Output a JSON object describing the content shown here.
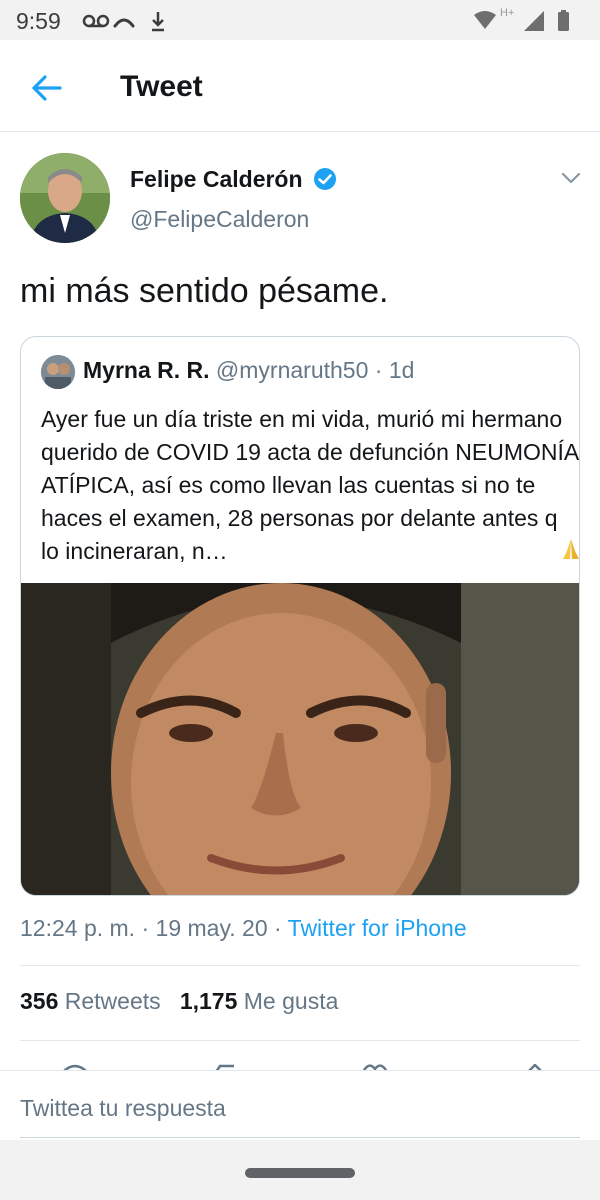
{
  "status_bar": {
    "time": "9:59",
    "network_label": "H+",
    "icons_left": [
      "voicemail-icon",
      "missed-call-icon",
      "download-icon"
    ],
    "icons_right": [
      "wifi-icon",
      "signal-icon",
      "battery-icon"
    ]
  },
  "header": {
    "title": "Tweet",
    "back_icon": "back-arrow-icon",
    "accent": "#1da1f2"
  },
  "tweet": {
    "author_name": "Felipe Calderón",
    "author_handle": "@FelipeCalderon",
    "verified": true,
    "text": "mi más sentido pésame.",
    "timestamp": "12:24 p. m.",
    "separator": "·",
    "date": "19 may. 20",
    "source": "Twitter for iPhone",
    "retweets_count": "356",
    "retweets_label": "Retweets",
    "likes_count": "1,175",
    "likes_label": "Me gusta"
  },
  "quoted_tweet": {
    "author_name": "Myrna R. R.",
    "author_handle": "@myrnaruth50",
    "separator": "·",
    "age": "1d",
    "text": "Ayer fue un día triste en mi vida, murió mi hermano querido de COVID 19 acta de defunción NEUMONÍA ATÍPICA, así es como llevan las cuentas si no te haces el examen, 28 personas por delante antes q lo incineraran, n…",
    "emoji_icon": "folded-hands-icon"
  },
  "reply": {
    "placeholder": "Twittea tu respuesta"
  }
}
